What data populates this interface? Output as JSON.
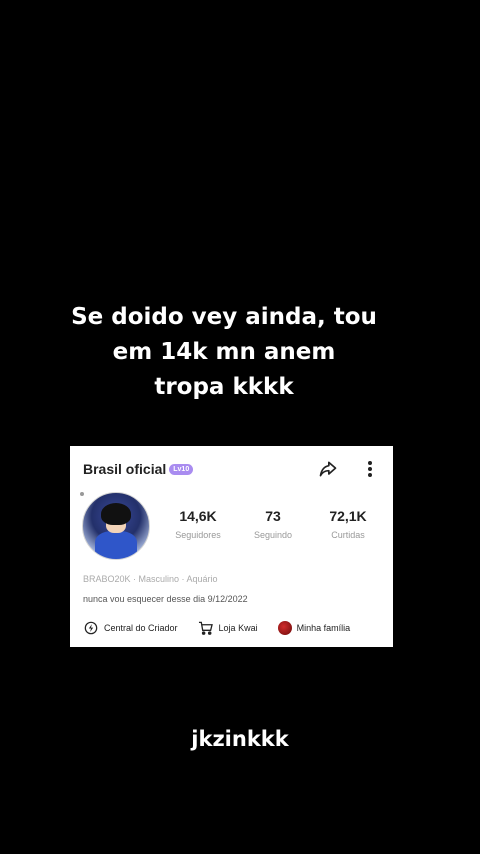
{
  "caption": {
    "line1": "Se doido vey ainda, tou",
    "line2": "em 14k mn anem",
    "line3": "tropa kkkk"
  },
  "profile": {
    "username": "Brasil oficial",
    "level_badge": "Lv10",
    "stats": [
      {
        "value": "14,6K",
        "label": "Seguidores"
      },
      {
        "value": "73",
        "label": "Seguindo"
      },
      {
        "value": "72,1K",
        "label": "Curtidas"
      }
    ],
    "meta": "BRABO20K · Masculino · Aquário",
    "bio": "nunca vou esquecer desse dia 9/12/2022",
    "links": [
      {
        "label": "Central do Criador",
        "icon": "lightning-circle-icon"
      },
      {
        "label": "Loja Kwai",
        "icon": "cart-icon"
      },
      {
        "label": "Minha família",
        "icon": "family-badge-icon"
      }
    ],
    "actions": {
      "share_icon": "share-icon",
      "more_icon": "more-vertical-icon"
    }
  },
  "watermark": "jkzinkkk",
  "colors": {
    "background": "#000000",
    "card": "#ffffff",
    "badge": "#a98cf0"
  }
}
